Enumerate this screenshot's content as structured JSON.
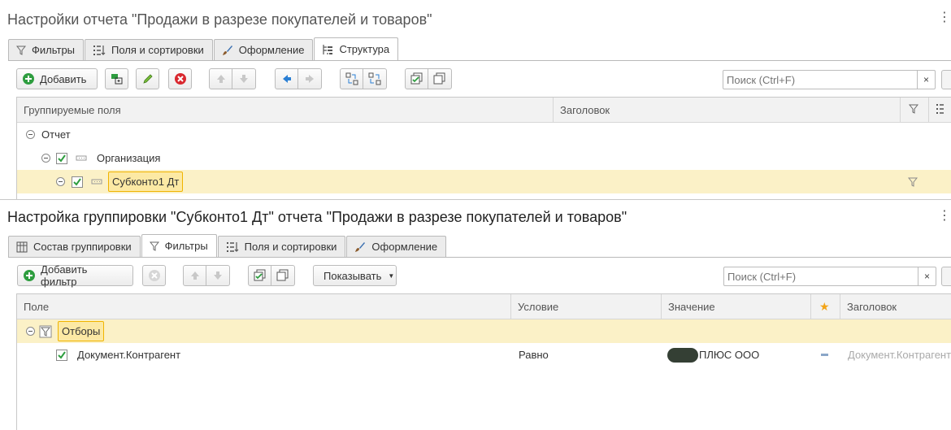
{
  "report_settings": {
    "title": "Настройки отчета \"Продажи в разрезе покупателей и товаров\"",
    "tabs": [
      {
        "label": "Фильтры",
        "icon": "funnel-icon"
      },
      {
        "label": "Поля и сортировки",
        "icon": "fields-icon"
      },
      {
        "label": "Оформление",
        "icon": "brush-icon"
      },
      {
        "label": "Структура",
        "icon": "structure-icon",
        "active": true
      }
    ],
    "toolbar": {
      "add_label": "Добавить",
      "search_placeholder": "Поиск (Ctrl+F)",
      "search_clear": "×"
    },
    "grid": {
      "columns": [
        "Группируемые поля",
        "Заголовок"
      ],
      "rows": [
        {
          "label": "Отчет",
          "level": 0
        },
        {
          "label": "Организация",
          "level": 1,
          "checked": true
        },
        {
          "label": "Субконто1 Дт",
          "level": 2,
          "checked": true,
          "selected": true
        }
      ]
    }
  },
  "grouping_settings": {
    "title": "Настройка группировки \"Субконто1 Дт\" отчета \"Продажи в разрезе покупателей и товаров\"",
    "tabs": [
      {
        "label": "Состав группировки",
        "icon": "table-icon"
      },
      {
        "label": "Фильтры",
        "icon": "funnel-icon",
        "active": true
      },
      {
        "label": "Поля и сортировки",
        "icon": "fields-icon"
      },
      {
        "label": "Оформление",
        "icon": "brush-icon"
      }
    ],
    "toolbar": {
      "add_filter_label": "Добавить фильтр",
      "show_label": "Показывать",
      "search_placeholder": "Поиск (Ctrl+F)",
      "search_clear": "×"
    },
    "grid": {
      "columns": [
        "Поле",
        "Условие",
        "Значение",
        "★",
        "Заголовок"
      ],
      "group_row": {
        "label": "Отборы"
      },
      "rows": [
        {
          "field": "Документ.Контрагент",
          "condition": "Равно",
          "value": "ПЛЮС ООО",
          "title": "Документ.Контрагент",
          "checked": true
        }
      ]
    }
  },
  "colors": {
    "accent_green": "#2e9d3f",
    "delete_red": "#d9282f",
    "arrow_blue": "#2a7fd4",
    "selection": "#fbf1c7",
    "highlight_border": "#f0b400",
    "star": "#f3a417"
  }
}
